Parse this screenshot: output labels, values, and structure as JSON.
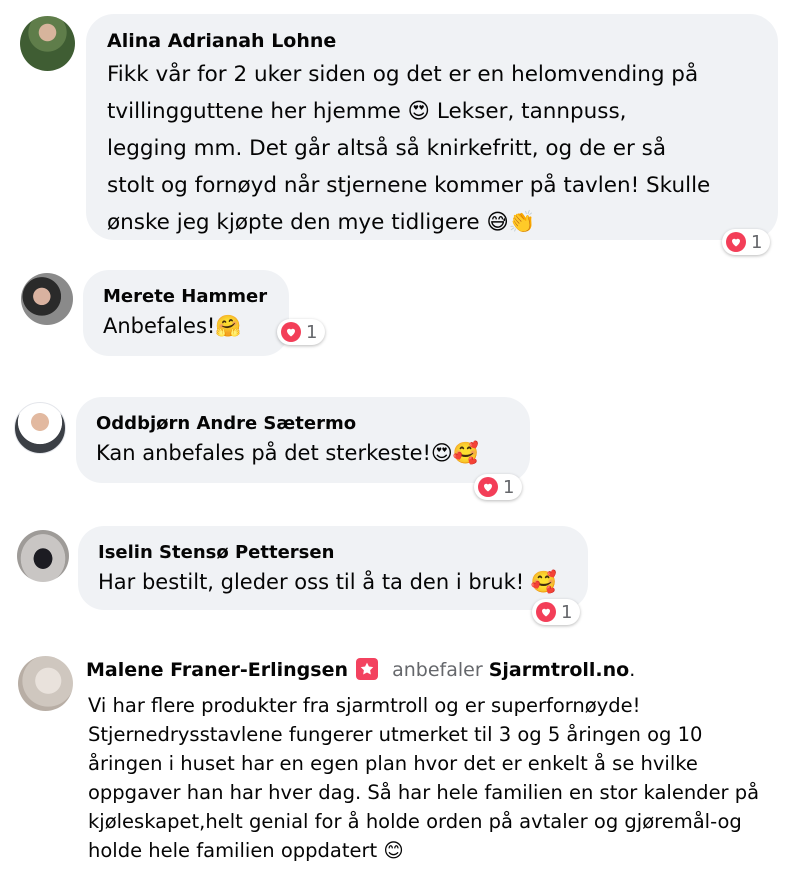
{
  "comments": [
    {
      "author": "Alina Adrianah Lohne",
      "text": "Fikk vår for 2 uker siden og det er en helomvending på\ntvillingguttene her hjemme 😍 Lekser, tannpuss,\nlegging mm. Det går altså så knirkefritt, og de er så\nstolt og fornøyd når stjernene kommer på tavlen! Skulle\nønske jeg kjøpte den mye tidligere 😅👏",
      "reaction_count": "1"
    },
    {
      "author": "Merete Hammer",
      "text": "Anbefales!🤗",
      "reaction_count": "1"
    },
    {
      "author": "Oddbjørn Andre Sætermo",
      "text": "Kan anbefales på det sterkeste!😍🥰",
      "reaction_count": "1"
    },
    {
      "author": "Iselin Stensø Pettersen",
      "text": "Har bestilt, gleder oss til å ta den i bruk! 🥰",
      "reaction_count": "1"
    }
  ],
  "review": {
    "author": "Malene Franer-Erlingsen",
    "recommends_label": "anbefaler",
    "page_name": "Sjarmtroll.no",
    "suffix": ".",
    "text": "Vi har flere produkter fra sjarmtroll og er superfornøyde!\nStjernedrysstavlene fungerer utmerket til 3 og 5 åringen og 10\nåringen i huset har en egen plan hvor det er enkelt å se hvilke\noppgaver han har hver dag. Så har hele familien en stor kalender på\nkjøleskapet,helt genial for å holde orden på avtaler og gjøremål-og\nholde hele familien oppdatert 😊"
  },
  "colors": {
    "bubble": "#f0f2f5",
    "heart": "#f33e58",
    "muted_text": "#65676b",
    "review_badge": "#f3425f"
  },
  "icons": [
    "heart-reaction-icon",
    "recommendation-badge-icon"
  ]
}
